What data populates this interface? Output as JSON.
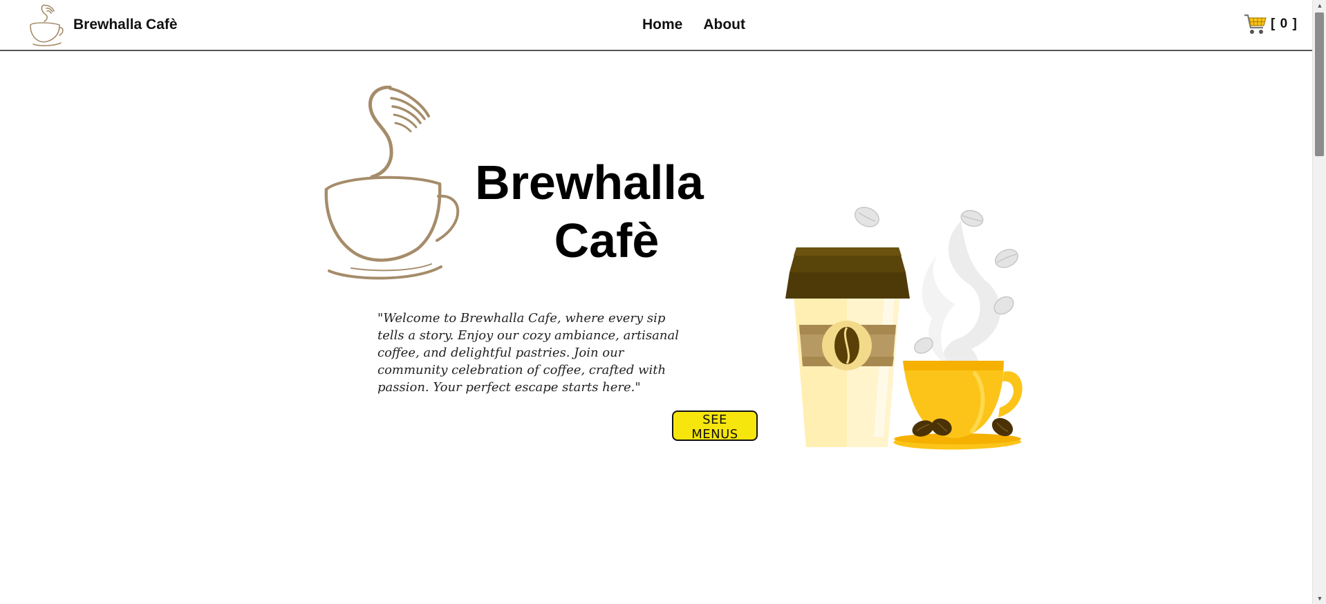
{
  "header": {
    "brand_name": "Brewhalla Cafè",
    "nav": [
      {
        "label": "Home"
      },
      {
        "label": "About"
      }
    ],
    "cart_count": "[ 0 ]"
  },
  "hero": {
    "title_line1": "Brewhalla",
    "title_line2": "Cafè",
    "welcome_text": "\"Welcome to Brewhalla Cafe, where every sip tells a story. Enjoy our cozy ambiance, artisanal coffee, and delightful pastries. Join our community celebration of coffee, crafted with passion. Your perfect escape starts here.\"",
    "cta_label": "SEE MENUS"
  },
  "icons": {
    "brand_logo": "coffee-cup-steam-icon",
    "cart": "shopping-cart-icon",
    "hero_logo": "coffee-cup-steam-icon",
    "hero_art": "coffee-cups-illustration"
  },
  "colors": {
    "accent": "#f6e60e",
    "logo_brown": "#a58c6a",
    "cup_yellow": "#fcc419",
    "lid_brown": "#4d3a08"
  }
}
